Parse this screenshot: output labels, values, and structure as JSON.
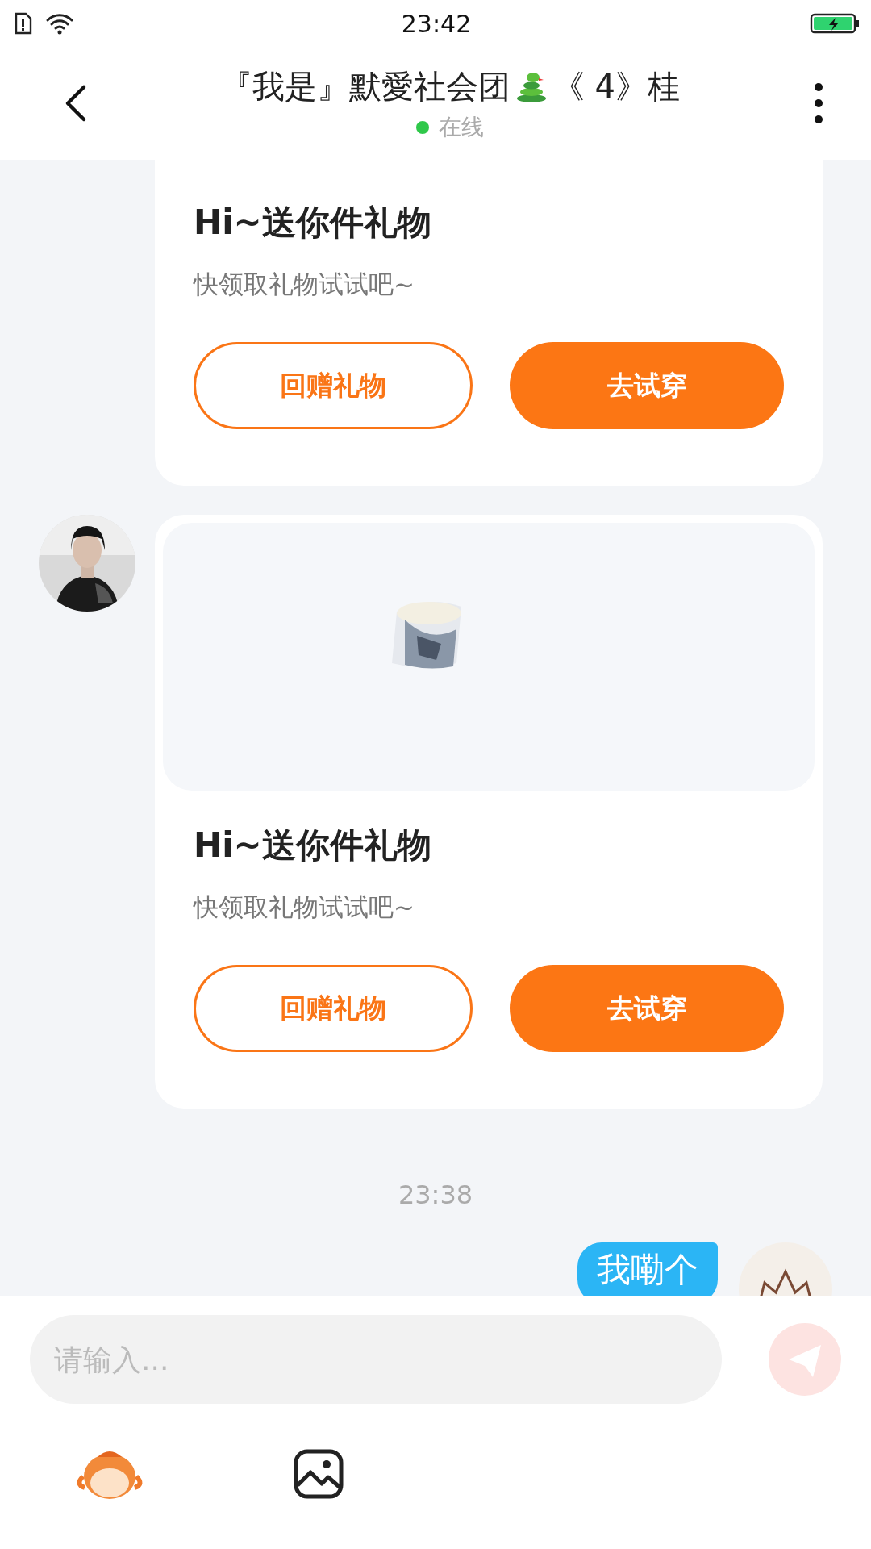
{
  "status_bar": {
    "time": "23:42"
  },
  "header": {
    "title_before": "『我是』默愛社会团",
    "title_after": "《 4》桂",
    "status": "在线",
    "online": true
  },
  "messages": [
    {
      "kind": "gift",
      "has_image": false,
      "title": "Hi~送你件礼物",
      "subtitle": "快领取礼物试试吧~",
      "buttons": [
        {
          "label": "回赠礼物",
          "kind": "outline"
        },
        {
          "label": "去试穿",
          "kind": "filled"
        }
      ]
    },
    {
      "kind": "gift",
      "has_image": true,
      "title": "Hi~送你件礼物",
      "subtitle": "快领取礼物试试吧~",
      "buttons": [
        {
          "label": "回赠礼物",
          "kind": "outline"
        },
        {
          "label": "去试穿",
          "kind": "filled"
        }
      ]
    },
    {
      "kind": "time",
      "text": "23:38"
    },
    {
      "kind": "text",
      "text": "我嘞个"
    }
  ],
  "composer": {
    "placeholder": "请输入..."
  }
}
